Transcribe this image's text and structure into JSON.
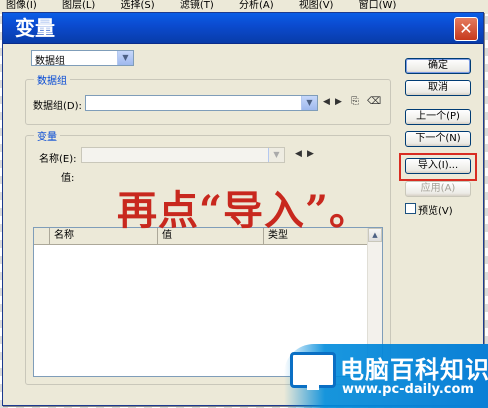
{
  "background_menu": [
    "图像(I)",
    "图层(L)",
    "选择(S)",
    "滤镜(T)",
    "分析(A)",
    "视图(V)",
    "窗口(W)"
  ],
  "dialog": {
    "title": "变量",
    "close_label": "✕",
    "type_select": {
      "value": "数据组"
    },
    "dataset_group": {
      "legend": "数据组",
      "label": "数据组(D):",
      "value": ""
    },
    "variable_group": {
      "legend": "变量",
      "name_label": "名称(E):",
      "name_value": "",
      "value_label": "值:",
      "table_headers": [
        "名称",
        "值",
        "类型"
      ]
    },
    "buttons": {
      "ok": "确定",
      "cancel": "取消",
      "prev": "上一个(P)",
      "next": "下一个(N)",
      "import": "导入(I)...",
      "apply": "应用(A)"
    },
    "preview_label": "预览(V)",
    "preview_checked": false
  },
  "annotation": "再点“导入”。",
  "watermark": {
    "title": "电脑百科知识",
    "url": "www.pc-daily.com"
  },
  "colors": {
    "title_bar": "#0b4bd0",
    "annotation": "#c8281e",
    "highlight": "#d82c22",
    "watermark": "#0a7fd6"
  }
}
